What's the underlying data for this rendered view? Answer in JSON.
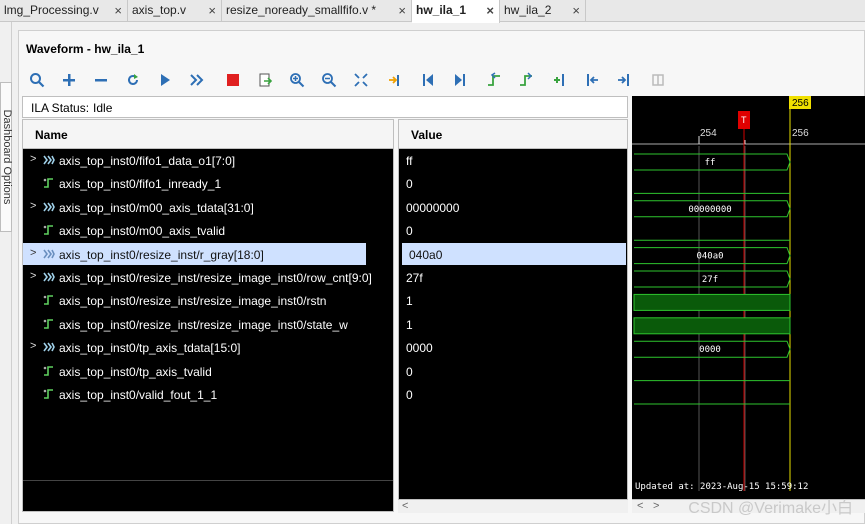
{
  "tabs": [
    {
      "label": "lmg_Processing.v",
      "close": "×"
    },
    {
      "label": "axis_top.v",
      "close": "×"
    },
    {
      "label": "resize_noready_smallfifo.v *",
      "close": "×"
    },
    {
      "label": "hw_ila_1",
      "close": "×"
    },
    {
      "label": "hw_ila_2",
      "close": "×"
    }
  ],
  "left": {
    "dashboard_label": "Dashboard Options"
  },
  "panel": {
    "title": "Waveform - hw_ila_1"
  },
  "toolbar": [
    "search-icon",
    "plus-icon",
    "minus-icon",
    "rerun-icon",
    "play-icon",
    "fast-forward-icon",
    "stop-icon",
    "export-icon",
    "zoom-in-icon",
    "zoom-out-icon",
    "fit-icon",
    "go-to-cursor-icon",
    "go-to-start-icon",
    "go-to-end-icon",
    "prev-transition-icon",
    "next-transition-icon",
    "add-marker-icon",
    "prev-marker-icon",
    "next-marker-icon",
    "swap-cursors-icon"
  ],
  "status": {
    "label": "ILA Status:",
    "value": "Idle"
  },
  "columns": {
    "name": "Name",
    "value": "Value"
  },
  "signals": [
    {
      "name": "axis_top_inst0/fifo1_data_o1[7:0]",
      "value": "ff",
      "bus": true,
      "wave": "ff"
    },
    {
      "name": "axis_top_inst0/fifo1_inready_1",
      "value": "0",
      "bus": false,
      "wave": ""
    },
    {
      "name": "axis_top_inst0/m00_axis_tdata[31:0]",
      "value": "00000000",
      "bus": true,
      "wave": "00000000"
    },
    {
      "name": "axis_top_inst0/m00_axis_tvalid",
      "value": "0",
      "bus": false,
      "wave": ""
    },
    {
      "name": "axis_top_inst0/resize_inst/r_gray[18:0]",
      "value": "040a0",
      "bus": true,
      "wave": "040a0"
    },
    {
      "name": "axis_top_inst0/resize_inst/resize_image_inst0/row_cnt[9:0]",
      "value": "27f",
      "bus": true,
      "wave": "27f"
    },
    {
      "name": "axis_top_inst0/resize_inst/resize_image_inst0/rstn",
      "value": "1",
      "bus": false,
      "wave": ""
    },
    {
      "name": "axis_top_inst0/resize_inst/resize_image_inst0/state_w",
      "value": "1",
      "bus": false,
      "wave": ""
    },
    {
      "name": "axis_top_inst0/tp_axis_tdata[15:0]",
      "value": "0000",
      "bus": true,
      "wave": "0000"
    },
    {
      "name": "axis_top_inst0/tp_axis_tvalid",
      "value": "0",
      "bus": false,
      "wave": ""
    },
    {
      "name": "axis_top_inst0/valid_fout_1_1",
      "value": "0",
      "bus": false,
      "wave": ""
    }
  ],
  "selected_index": 4,
  "wave": {
    "cursor_label": "256",
    "marker_label": "T",
    "ticks": [
      "254",
      "256"
    ],
    "updated_text": "Updated at: 2023-Aug-15 15:59:12"
  },
  "scroll": {
    "left": "<",
    "right": ">"
  },
  "watermark": "CSDN @Verimake小白"
}
